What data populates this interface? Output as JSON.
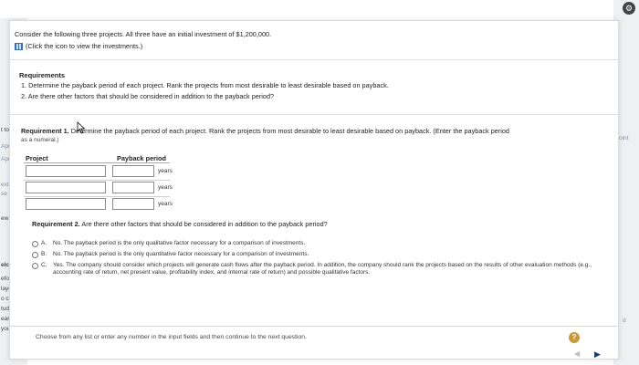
{
  "background": {
    "left_fragments": [
      "t to",
      "Apr",
      "Apr",
      "ext",
      "se",
      "ew A",
      "elcon",
      "efore y",
      "layers",
      "o chec",
      "tudy pl",
      "earn H",
      "you're s"
    ],
    "right_fragments": [
      "oint",
      "d"
    ]
  },
  "dialog": {
    "intro": "Consider the following three projects. All three have an initial investment of $1,200,000.",
    "intro_link": "(Click the icon to view the investments.)",
    "requirements": {
      "title": "Requirements",
      "items": [
        "1.   Determine the payback period of each project. Rank the projects from most desirable to least desirable based on payback.",
        "2.   Are there other factors that should be considered in addition to the payback period?"
      ]
    },
    "req1": {
      "bold": "Requirement 1.",
      "text": " Determine the payback period of each project. Rank the projects from most desirable to least desirable based on payback. (Enter the payback period",
      "sub": "as a numeral.)"
    },
    "table": {
      "col_project": "Project",
      "col_payback": "Payback period",
      "unit": "years",
      "rows": [
        {
          "project": "",
          "payback": ""
        },
        {
          "project": "",
          "payback": ""
        },
        {
          "project": "",
          "payback": ""
        }
      ]
    },
    "req2": {
      "bold": "Requirement 2.",
      "text": " Are there other factors that should be considered in addition to the payback period?",
      "options": [
        {
          "key": "A.",
          "text": "No. The payback period is the only qualitative factor necessary for a comparison of investments."
        },
        {
          "key": "B.",
          "text": "No. The payback period is the only quantitative factor necessary for a comparison of investments."
        },
        {
          "key": "C.",
          "text": "Yes. The company should consider which projects will generate cash flows after the payback period. In addition, the company should rank the projects based on the results of other evaluation methods (e.g., accounting rate of return, net present value, profitability index, and internal rate of return) and possible qualitative factors."
        }
      ]
    },
    "footer": "Choose from any list or enter any number in the input fields and then continue to the next question.",
    "help_label": "?"
  }
}
